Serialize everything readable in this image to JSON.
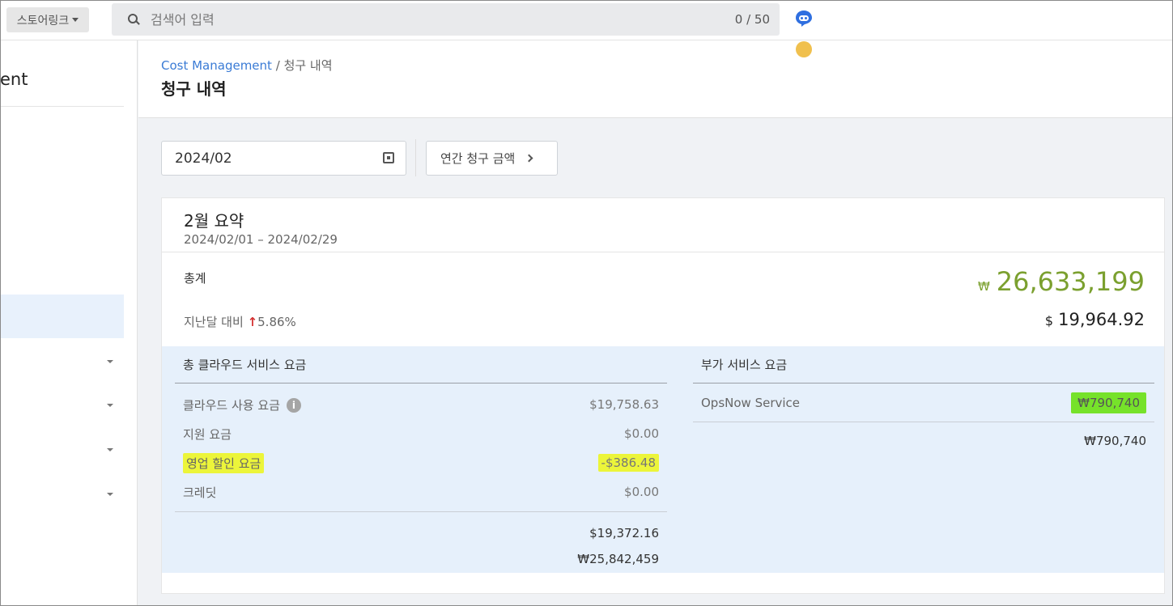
{
  "topbar": {
    "workspace_label": "스토어링크",
    "search_placeholder": "검색어 입력",
    "search_counter": "0 / 50"
  },
  "sidebar": {
    "title": "ent"
  },
  "header": {
    "breadcrumb_link": "Cost Management",
    "breadcrumb_sep": "/",
    "breadcrumb_current": "청구 내역",
    "title": "청구 내역"
  },
  "controls": {
    "date_value": "2024/02",
    "annual_button": "연간 청구 금액"
  },
  "summary": {
    "title": "2월 요약",
    "period": "2024/02/01 – 2024/02/29",
    "total_label": "총계",
    "total_krw_symbol": "₩",
    "total_krw": "26,633,199",
    "mom_label": "지난달 대비",
    "mom_arrow": "↑",
    "mom_value": "5.86%",
    "total_usd_symbol": "$",
    "total_usd": "19,964.92",
    "accent_color": "#7ba02f"
  },
  "cloud": {
    "header": "총 클라우드 서비스 요금",
    "rows": [
      {
        "label": "클라우드 사용 요금",
        "value": "$19,758.63"
      },
      {
        "label": "지원 요금",
        "value": "$0.00"
      },
      {
        "label": "영업 할인 요금",
        "value": "-$386.48"
      },
      {
        "label": "크레딧",
        "value": "$0.00"
      }
    ],
    "subtotal_usd": "$19,372.16",
    "subtotal_krw": "₩25,842,459"
  },
  "addon": {
    "header": "부가 서비스 요금",
    "rows": [
      {
        "label": "OpsNow Service",
        "value": "₩790,740"
      }
    ],
    "subtotal_krw": "₩790,740"
  }
}
